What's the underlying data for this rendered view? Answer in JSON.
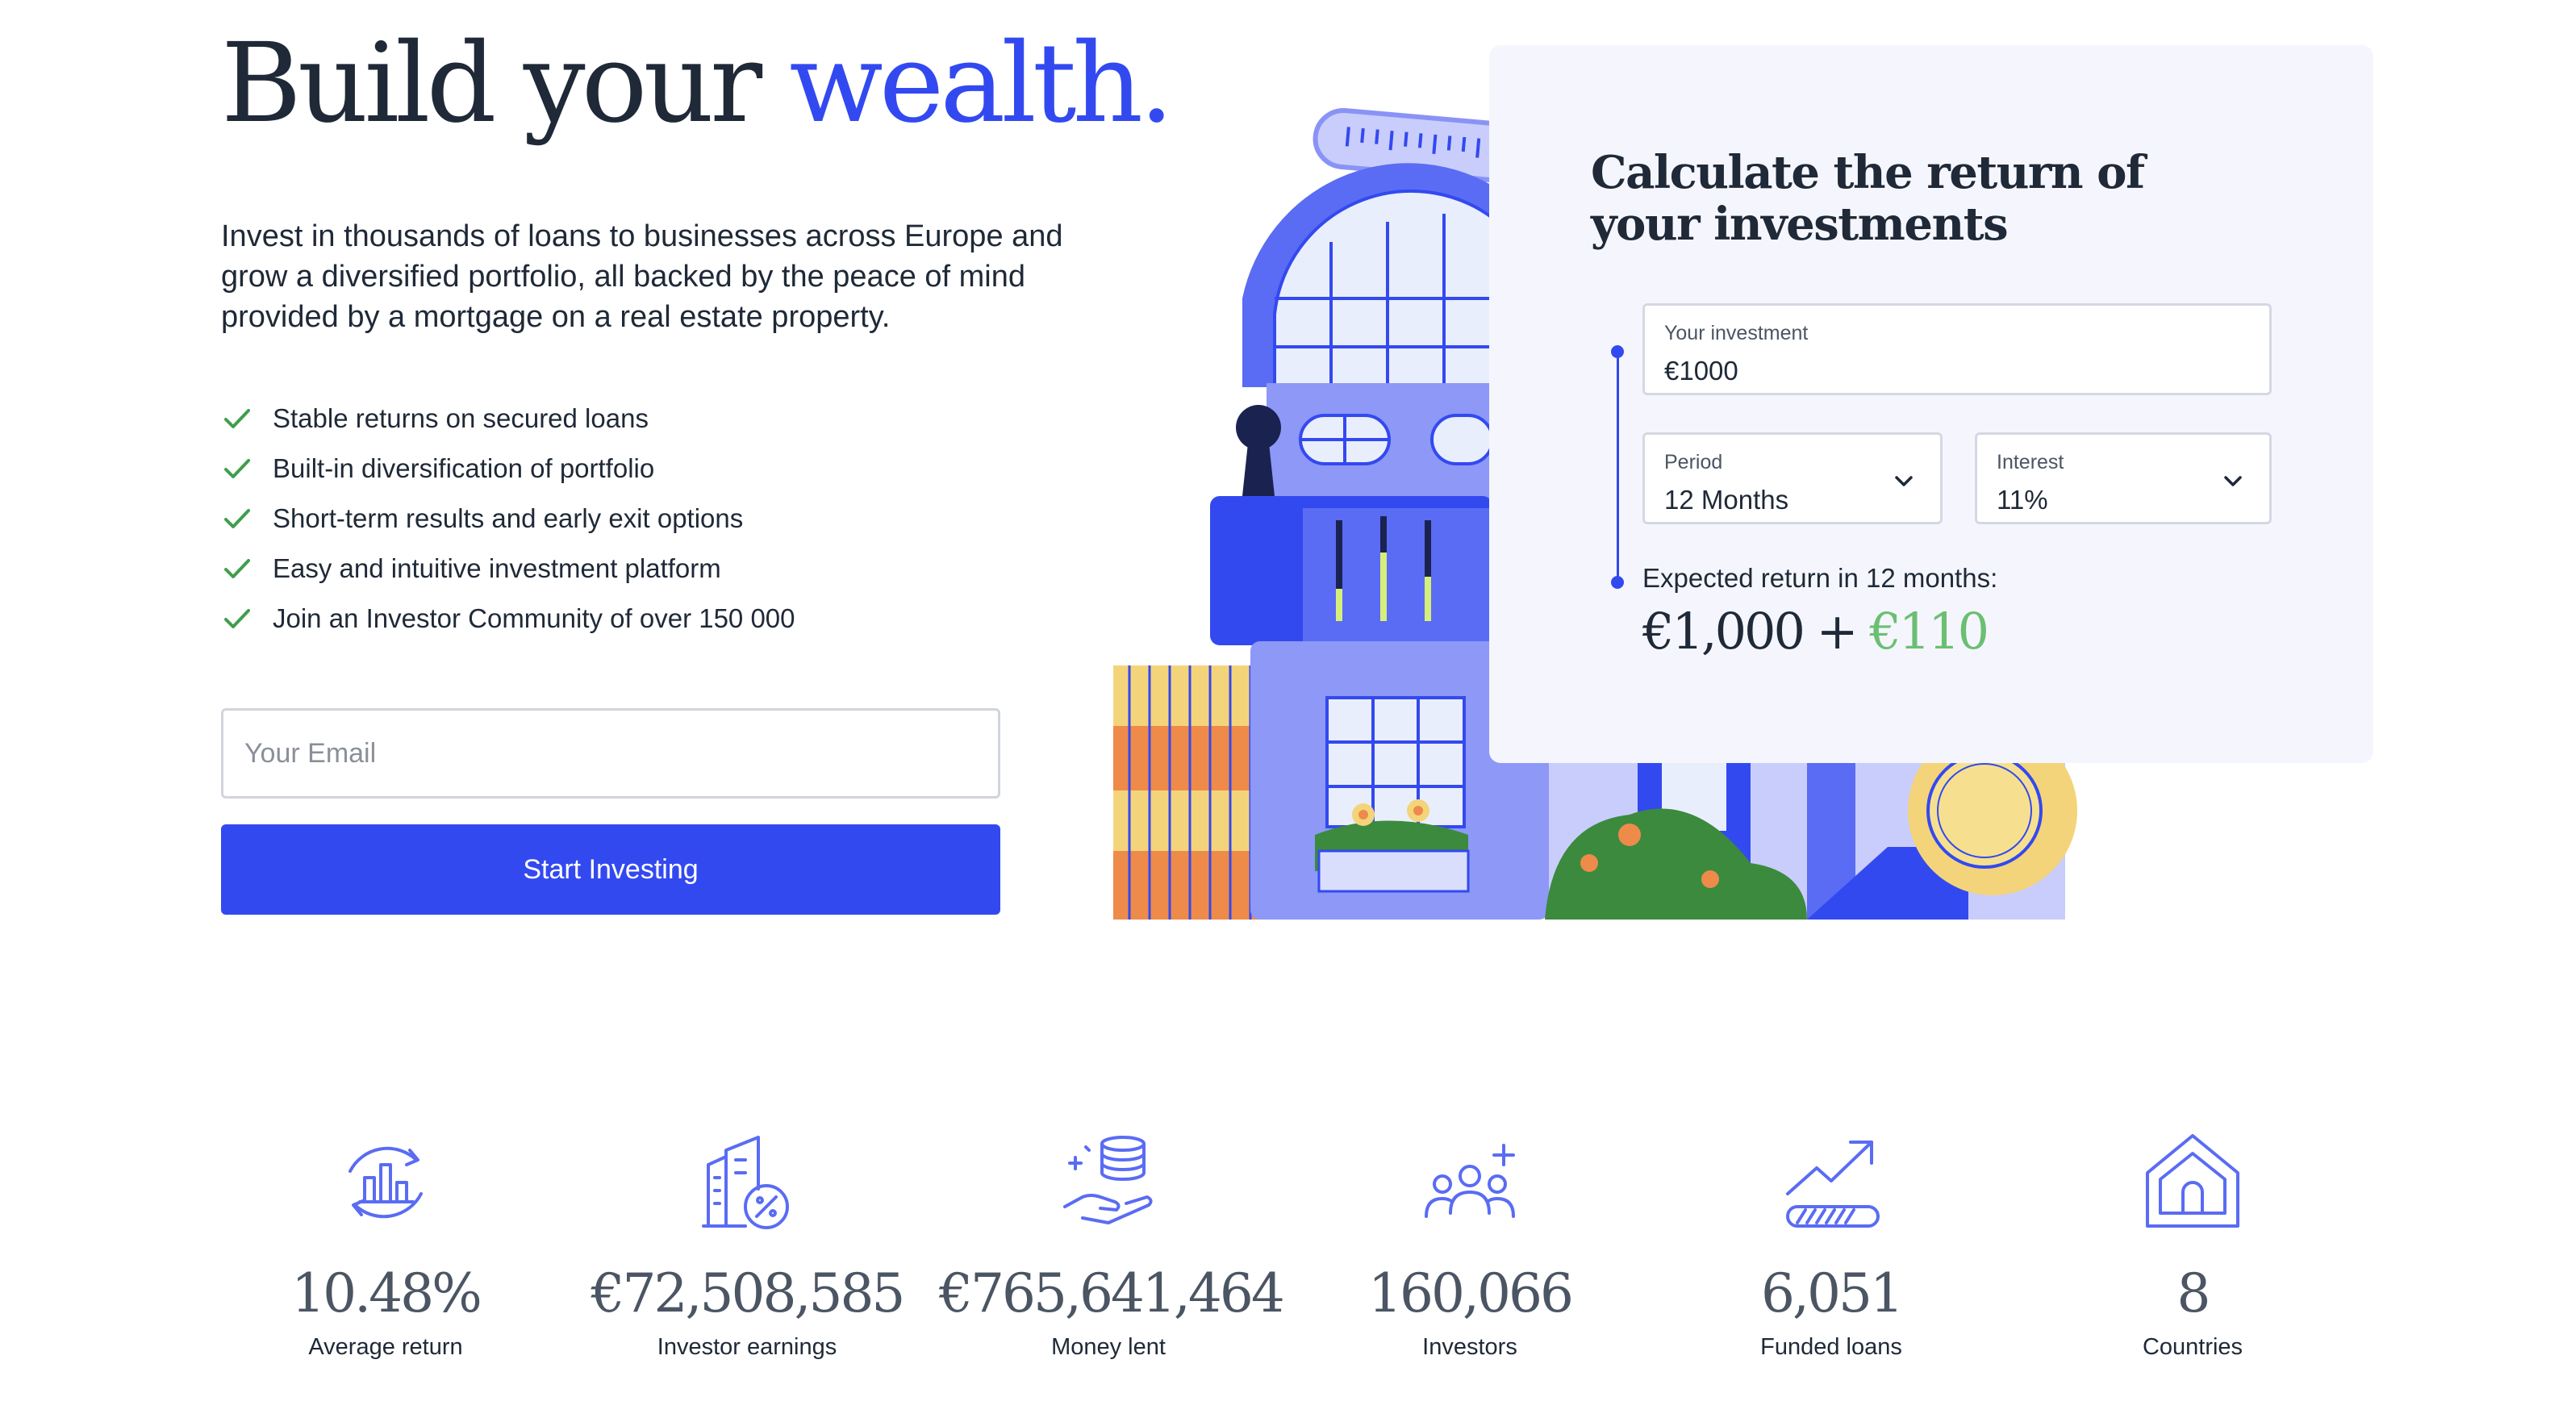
{
  "hero": {
    "title_main": "Build your",
    "title_accent": "wealth.",
    "intro": "Invest in thousands of loans to businesses across Europe and grow a diversified portfolio, all backed by the peace of mind provided by a mortgage on a real estate property.",
    "features": [
      "Stable returns on secured loans",
      "Built-in diversification of portfolio",
      "Short-term results and early exit options",
      "Easy and intuitive investment platform",
      "Join an Investor Community of over 150 000"
    ],
    "email_placeholder": "Your Email",
    "start_button": "Start Investing"
  },
  "calculator": {
    "title": "Calculate the return of your investments",
    "investment_label": "Your investment",
    "investment_value": "€1000",
    "period_label": "Period",
    "period_value": "12 Months",
    "interest_label": "Interest",
    "interest_value": "11%",
    "expected_label": "Expected return in 12 months:",
    "expected_principal": "€1,000",
    "expected_plus": "+",
    "expected_gain": "€110"
  },
  "stats": [
    {
      "icon": "bar-chart-cycle-icon",
      "value": "10.48%",
      "label": "Average return"
    },
    {
      "icon": "building-percent-icon",
      "value": "€72,508,585",
      "label": "Investor earnings"
    },
    {
      "icon": "hand-coins-icon",
      "value": "€765,641,464",
      "label": "Money lent"
    },
    {
      "icon": "people-add-icon",
      "value": "160,066",
      "label": "Investors"
    },
    {
      "icon": "growth-arrow-icon",
      "value": "6,051",
      "label": "Funded loans"
    },
    {
      "icon": "house-icon",
      "value": "8",
      "label": "Countries"
    }
  ],
  "colors": {
    "accent": "#3349f0",
    "gain": "#6bbf73",
    "check": "#3f9e4c",
    "card_bg": "#f5f6fd"
  }
}
